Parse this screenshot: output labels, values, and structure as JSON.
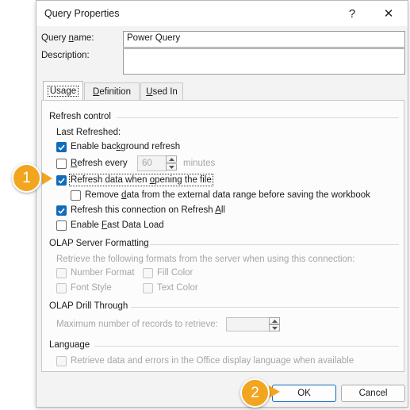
{
  "window": {
    "title": "Query Properties",
    "help_glyph": "?",
    "close_glyph": "✕"
  },
  "query_name": {
    "label_pre": "Query ",
    "label_key": "n",
    "label_post": "ame:",
    "value": "Power Query"
  },
  "description": {
    "label": "Description:",
    "value": ""
  },
  "tabs": [
    {
      "pre": "Usa",
      "key": "g",
      "post": "e",
      "active": true
    },
    {
      "pre": "",
      "key": "D",
      "post": "efinition",
      "active": false
    },
    {
      "pre": "",
      "key": "U",
      "post": "sed In",
      "active": false
    }
  ],
  "refresh_control": {
    "heading": "Refresh control",
    "last_refreshed": "Last Refreshed:",
    "enable_background": {
      "pre": "Enable bac",
      "key": "k",
      "post": "ground refresh",
      "checked": true
    },
    "refresh_every": {
      "pre": "",
      "key": "R",
      "post": "efresh every",
      "checked": false,
      "value": "60",
      "unit": "minutes"
    },
    "refresh_on_open": {
      "pre": "Refresh data when ",
      "key": "o",
      "post": "pening the file",
      "checked": true
    },
    "remove_data": {
      "pre": "Remove ",
      "key": "d",
      "post": "ata from the external data range before saving the workbook",
      "checked": false
    },
    "refresh_all": {
      "pre": "Refresh this connection on Refresh ",
      "key": "A",
      "post": "ll",
      "checked": true
    },
    "fast_load": {
      "pre": "Enable ",
      "key": "F",
      "post": "ast Data Load",
      "checked": false
    }
  },
  "olap_formatting": {
    "heading": "OLAP Server Formatting",
    "description": "Retrieve the following formats from the server when using this connection:",
    "number_format": "Number Format",
    "fill_color": "Fill Color",
    "font_style": "Font Style",
    "text_color": "Text Color"
  },
  "olap_drill": {
    "heading": "OLAP Drill Through",
    "max_records_label": "Maximum number of records to retrieve:",
    "max_records_value": ""
  },
  "language": {
    "heading": "Language",
    "retrieve_label": "Retrieve data and errors in the Office display language when available"
  },
  "buttons": {
    "ok": "OK",
    "cancel": "Cancel"
  },
  "callouts": {
    "one": "1",
    "two": "2"
  },
  "colors": {
    "accent": "#0f6cbd",
    "callout": "#f2a51f"
  }
}
